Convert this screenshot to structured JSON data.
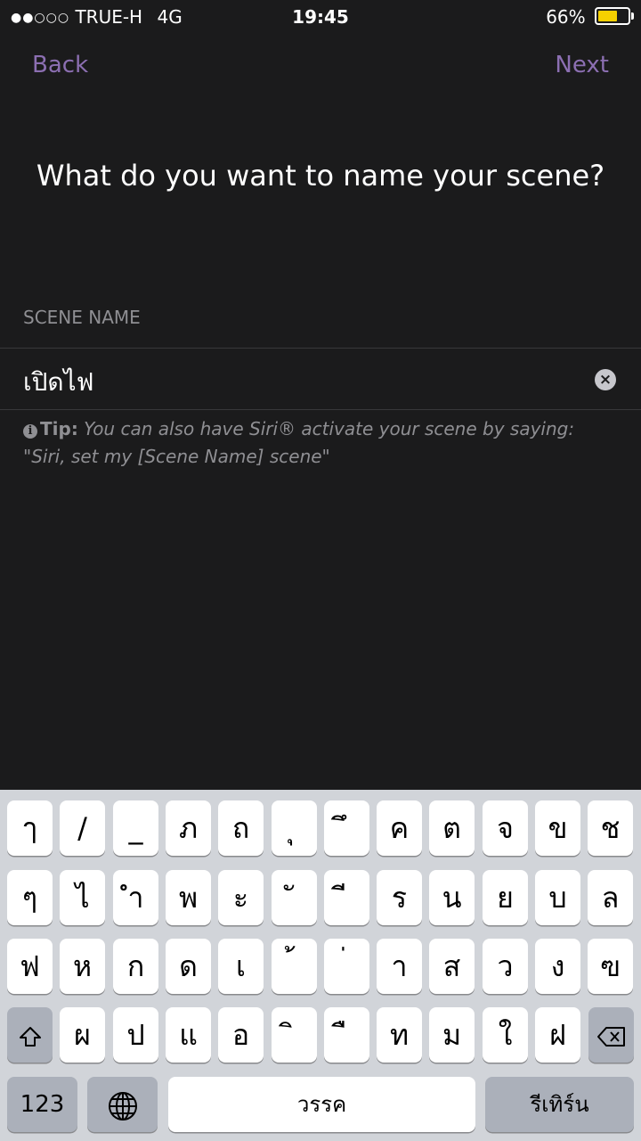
{
  "status_bar": {
    "signal": "●●○○○",
    "carrier": "TRUE-H",
    "network": "4G",
    "time": "19:45",
    "battery_percent": "66%",
    "battery_level": 0.66,
    "battery_color": "#f5d000"
  },
  "nav": {
    "back_label": "Back",
    "next_label": "Next",
    "accent_color": "#8c6fb2"
  },
  "title": "What do you want to name your scene?",
  "scene_name": {
    "label": "SCENE NAME",
    "value": "เปิดไฟ",
    "clear_icon": "clear-icon"
  },
  "tip": {
    "icon": "info-icon",
    "label": "Tip:",
    "text": "You can also have Siri® activate your scene by saying: \"Siri, set my [Scene Name] scene\""
  },
  "keyboard": {
    "row1": [
      "ๅ",
      "/",
      "_",
      "ภ",
      "ถ",
      "ุ",
      "ึ",
      "ค",
      "ต",
      "จ",
      "ข",
      "ช"
    ],
    "row2": [
      "ๆ",
      "ไ",
      "ำ",
      "พ",
      "ะ",
      "ั",
      "ี",
      "ร",
      "น",
      "ย",
      "บ",
      "ล"
    ],
    "row3": [
      "ฟ",
      "ห",
      "ก",
      "ด",
      "เ",
      "้",
      "่",
      "า",
      "ส",
      "ว",
      "ง",
      "ฃ"
    ],
    "row4": [
      "ผ",
      "ป",
      "แ",
      "อ",
      "ิ",
      "ื",
      "ท",
      "ม",
      "ใ",
      "ฝ"
    ],
    "shift_icon": "shift-icon",
    "delete_icon": "delete-icon",
    "globe_icon": "globe-icon",
    "numbers_label": "123",
    "space_label": "วรรค",
    "return_label": "รีเทิร์น"
  }
}
